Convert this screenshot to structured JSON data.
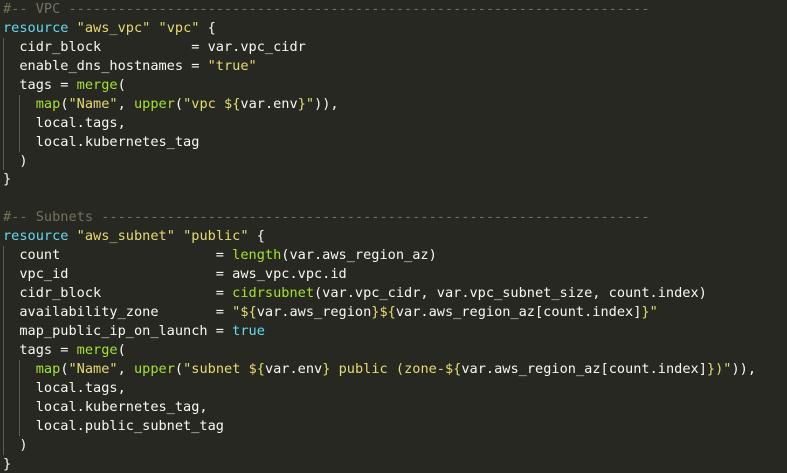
{
  "editor": {
    "theme_colors": {
      "background": "#272822",
      "keyword": "#66d9ef",
      "string": "#e6db74",
      "function": "#a6e22e",
      "comment": "#75715e",
      "text": "#f8f8f2"
    },
    "lines": [
      {
        "indent": 0,
        "tokens": [
          {
            "t": "cmt",
            "v": "#-- VPC -----------------------------------------------------------------------"
          }
        ]
      },
      {
        "indent": 0,
        "tokens": [
          {
            "t": "kw",
            "v": "resource"
          },
          {
            "t": "plain",
            "v": " "
          },
          {
            "t": "str",
            "v": "\"aws_vpc\""
          },
          {
            "t": "plain",
            "v": " "
          },
          {
            "t": "str",
            "v": "\"vpc\""
          },
          {
            "t": "plain",
            "v": " {"
          }
        ]
      },
      {
        "indent": 1,
        "tokens": [
          {
            "t": "plain",
            "v": "  cidr_block           = var.vpc_cidr"
          }
        ]
      },
      {
        "indent": 1,
        "tokens": [
          {
            "t": "plain",
            "v": "  enable_dns_hostnames = "
          },
          {
            "t": "str",
            "v": "\"true\""
          }
        ]
      },
      {
        "indent": 1,
        "tokens": [
          {
            "t": "plain",
            "v": "  tags = "
          },
          {
            "t": "fn",
            "v": "merge"
          },
          {
            "t": "plain",
            "v": "("
          }
        ]
      },
      {
        "indent": 2,
        "tokens": [
          {
            "t": "plain",
            "v": "    "
          },
          {
            "t": "fn",
            "v": "map"
          },
          {
            "t": "plain",
            "v": "("
          },
          {
            "t": "str",
            "v": "\"Name\""
          },
          {
            "t": "plain",
            "v": ", "
          },
          {
            "t": "fn",
            "v": "upper"
          },
          {
            "t": "plain",
            "v": "("
          },
          {
            "t": "str",
            "v": "\"vpc ${"
          },
          {
            "t": "plain",
            "v": "var.env"
          },
          {
            "t": "str",
            "v": "}\""
          },
          {
            "t": "plain",
            "v": ")),"
          }
        ]
      },
      {
        "indent": 2,
        "tokens": [
          {
            "t": "plain",
            "v": "    local.tags,"
          }
        ]
      },
      {
        "indent": 2,
        "tokens": [
          {
            "t": "plain",
            "v": "    local.kubernetes_tag"
          }
        ]
      },
      {
        "indent": 1,
        "tokens": [
          {
            "t": "plain",
            "v": "  )"
          }
        ]
      },
      {
        "indent": 0,
        "tokens": [
          {
            "t": "plain",
            "v": "}"
          }
        ]
      },
      {
        "indent": 0,
        "tokens": [
          {
            "t": "plain",
            "v": ""
          }
        ]
      },
      {
        "indent": 0,
        "tokens": [
          {
            "t": "cmt",
            "v": "#-- Subnets -------------------------------------------------------------------"
          }
        ]
      },
      {
        "indent": 0,
        "tokens": [
          {
            "t": "kw",
            "v": "resource"
          },
          {
            "t": "plain",
            "v": " "
          },
          {
            "t": "str",
            "v": "\"aws_subnet\""
          },
          {
            "t": "plain",
            "v": " "
          },
          {
            "t": "str",
            "v": "\"public\""
          },
          {
            "t": "plain",
            "v": " {"
          }
        ]
      },
      {
        "indent": 1,
        "tokens": [
          {
            "t": "plain",
            "v": "  count                   = "
          },
          {
            "t": "fn",
            "v": "length"
          },
          {
            "t": "plain",
            "v": "(var.aws_region_az)"
          }
        ]
      },
      {
        "indent": 1,
        "tokens": [
          {
            "t": "plain",
            "v": "  vpc_id                  = aws_vpc.vpc.id"
          }
        ]
      },
      {
        "indent": 1,
        "tokens": [
          {
            "t": "plain",
            "v": "  cidr_block              = "
          },
          {
            "t": "fn",
            "v": "cidrsubnet"
          },
          {
            "t": "plain",
            "v": "(var.vpc_cidr, var.vpc_subnet_size, count.index)"
          }
        ]
      },
      {
        "indent": 1,
        "tokens": [
          {
            "t": "plain",
            "v": "  availability_zone       = "
          },
          {
            "t": "str",
            "v": "\"${"
          },
          {
            "t": "plain",
            "v": "var.aws_region"
          },
          {
            "t": "str",
            "v": "}${"
          },
          {
            "t": "plain",
            "v": "var.aws_region_az[count.index]"
          },
          {
            "t": "str",
            "v": "}\""
          }
        ]
      },
      {
        "indent": 1,
        "tokens": [
          {
            "t": "plain",
            "v": "  map_public_ip_on_launch = "
          },
          {
            "t": "kw",
            "v": "true"
          }
        ]
      },
      {
        "indent": 1,
        "tokens": [
          {
            "t": "plain",
            "v": "  tags = "
          },
          {
            "t": "fn",
            "v": "merge"
          },
          {
            "t": "plain",
            "v": "("
          }
        ]
      },
      {
        "indent": 2,
        "tokens": [
          {
            "t": "plain",
            "v": "    "
          },
          {
            "t": "fn",
            "v": "map"
          },
          {
            "t": "plain",
            "v": "("
          },
          {
            "t": "str",
            "v": "\"Name\""
          },
          {
            "t": "plain",
            "v": ", "
          },
          {
            "t": "fn",
            "v": "upper"
          },
          {
            "t": "plain",
            "v": "("
          },
          {
            "t": "str",
            "v": "\"subnet ${"
          },
          {
            "t": "plain",
            "v": "var.env"
          },
          {
            "t": "str",
            "v": "} public (zone-${"
          },
          {
            "t": "plain",
            "v": "var.aws_region_az[count.index]"
          },
          {
            "t": "str",
            "v": "})\""
          },
          {
            "t": "plain",
            "v": ")),"
          }
        ]
      },
      {
        "indent": 2,
        "tokens": [
          {
            "t": "plain",
            "v": "    local.tags,"
          }
        ]
      },
      {
        "indent": 2,
        "tokens": [
          {
            "t": "plain",
            "v": "    local.kubernetes_tag,"
          }
        ]
      },
      {
        "indent": 2,
        "tokens": [
          {
            "t": "plain",
            "v": "    local.public_subnet_tag"
          }
        ]
      },
      {
        "indent": 1,
        "tokens": [
          {
            "t": "plain",
            "v": "  )"
          }
        ]
      },
      {
        "indent": 0,
        "tokens": [
          {
            "t": "plain",
            "v": "}"
          }
        ]
      }
    ]
  }
}
